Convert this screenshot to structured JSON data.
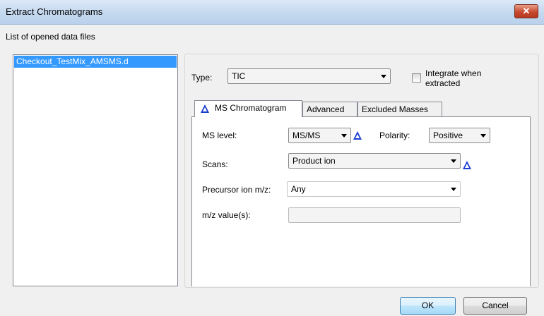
{
  "window": {
    "title": "Extract Chromatograms",
    "close_glyph": "✕"
  },
  "files": {
    "label": "List of opened data files",
    "items": [
      "Checkout_TestMix_AMSMS.d"
    ]
  },
  "type_row": {
    "label": "Type:",
    "value": "TIC",
    "integrate_label_line1": "Integrate when",
    "integrate_label_line2": "extracted"
  },
  "tabs": [
    {
      "label": "MS Chromatogram"
    },
    {
      "label": "Advanced"
    },
    {
      "label": "Excluded Masses"
    }
  ],
  "ms_tab": {
    "ms_level_label": "MS level:",
    "ms_level_value": "MS/MS",
    "polarity_label": "Polarity:",
    "polarity_value": "Positive",
    "scans_label": "Scans:",
    "scans_value": "Product ion",
    "precursor_label": "Precursor ion m/z:",
    "precursor_value": "Any",
    "mz_label": "m/z value(s):",
    "mz_value": ""
  },
  "buttons": {
    "ok": "OK",
    "cancel": "Cancel"
  },
  "colors": {
    "accent_icon": "#1b3fd1",
    "selection": "#3399ff"
  }
}
